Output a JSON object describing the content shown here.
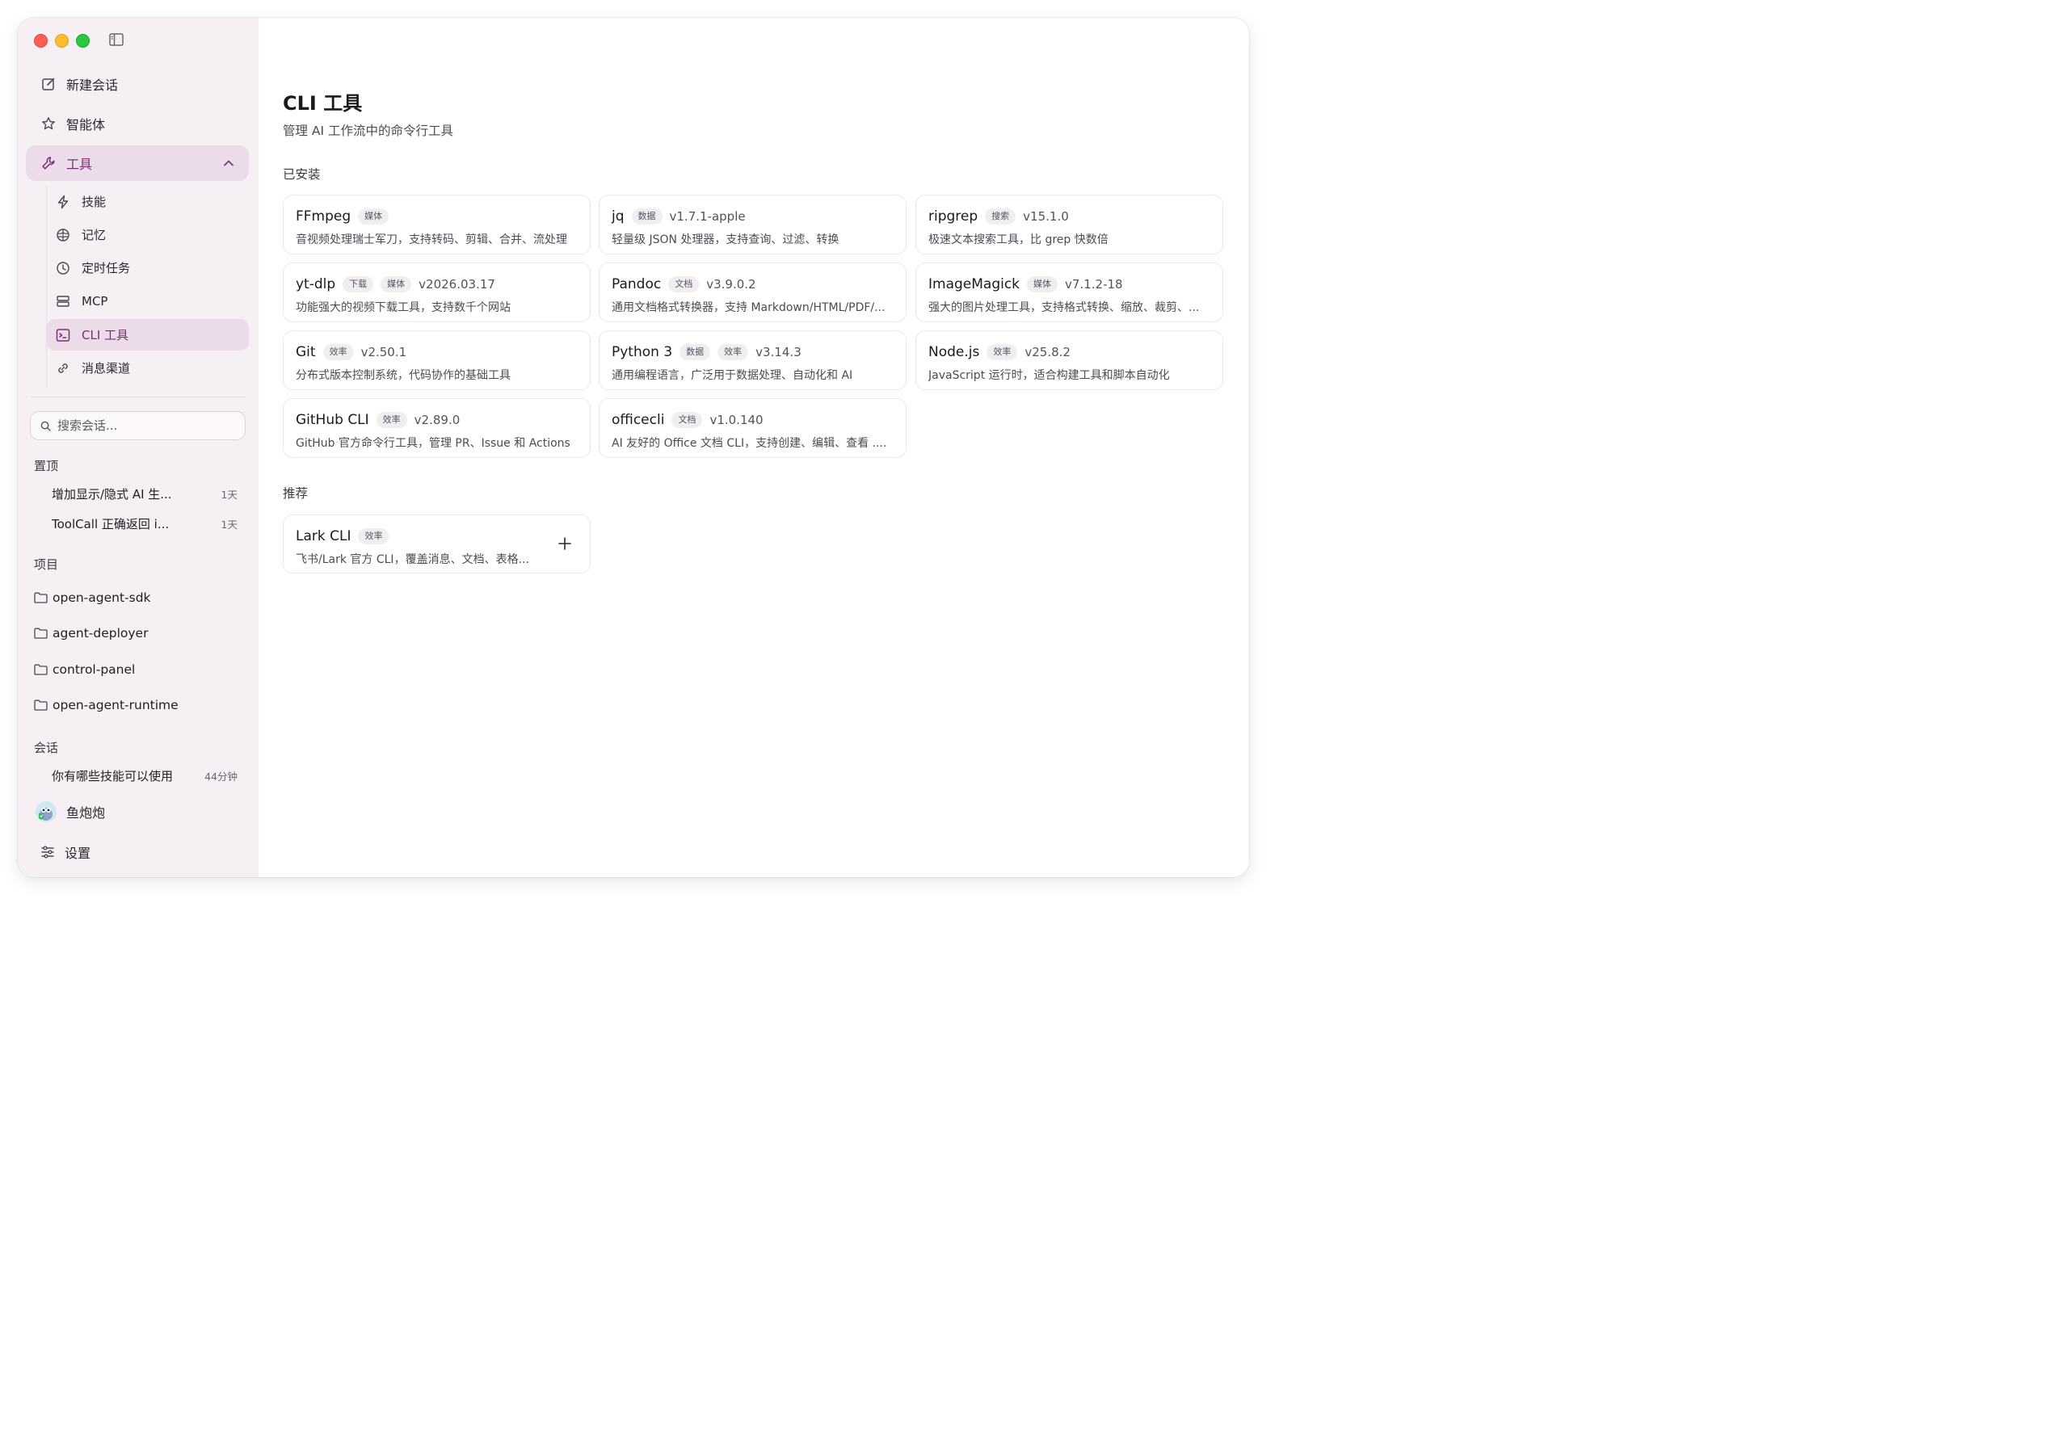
{
  "sidebar": {
    "nav": {
      "new_chat": "新建会话",
      "agents": "智能体",
      "tools": "工具"
    },
    "tools_sub": {
      "skills": "技能",
      "memory": "记忆",
      "scheduled": "定时任务",
      "mcp": "MCP",
      "cli": "CLI 工具",
      "channels": "消息渠道"
    },
    "search_placeholder": "搜索会话...",
    "pinned_label": "置顶",
    "pinned": [
      {
        "title": "增加显示/隐式 AI 生...",
        "time": "1天"
      },
      {
        "title": "ToolCall 正确返回 i...",
        "time": "1天"
      }
    ],
    "projects_label": "项目",
    "projects": [
      "open-agent-sdk",
      "agent-deployer",
      "control-panel",
      "open-agent-runtime"
    ],
    "conversations_label": "会话",
    "conversations": [
      {
        "title": "你有哪些技能可以使用",
        "time": "44分钟"
      }
    ],
    "user_name": "鱼炮炮",
    "settings": "设置"
  },
  "main": {
    "title": "CLI 工具",
    "subtitle": "管理 AI 工作流中的命令行工具",
    "installed_label": "已安装",
    "installed": [
      {
        "name": "FFmpeg",
        "tags": [
          "媒体"
        ],
        "version": "",
        "desc": "音视频处理瑞士军刀，支持转码、剪辑、合并、流处理"
      },
      {
        "name": "jq",
        "tags": [
          "数据"
        ],
        "version": "v1.7.1-apple",
        "desc": "轻量级 JSON 处理器，支持查询、过滤、转换"
      },
      {
        "name": "ripgrep",
        "tags": [
          "搜索"
        ],
        "version": "v15.1.0",
        "desc": "极速文本搜索工具，比 grep 快数倍"
      },
      {
        "name": "yt-dlp",
        "tags": [
          "下载",
          "媒体"
        ],
        "version": "v2026.03.17",
        "desc": "功能强大的视频下载工具，支持数千个网站"
      },
      {
        "name": "Pandoc",
        "tags": [
          "文档"
        ],
        "version": "v3.9.0.2",
        "desc": "通用文档格式转换器，支持 Markdown/HTML/PDF/..."
      },
      {
        "name": "ImageMagick",
        "tags": [
          "媒体"
        ],
        "version": "v7.1.2-18",
        "desc": "强大的图片处理工具，支持格式转换、缩放、裁剪、..."
      },
      {
        "name": "Git",
        "tags": [
          "效率"
        ],
        "version": "v2.50.1",
        "desc": "分布式版本控制系统，代码协作的基础工具"
      },
      {
        "name": "Python 3",
        "tags": [
          "数据",
          "效率"
        ],
        "version": "v3.14.3",
        "desc": "通用编程语言，广泛用于数据处理、自动化和 AI"
      },
      {
        "name": "Node.js",
        "tags": [
          "效率"
        ],
        "version": "v25.8.2",
        "desc": "JavaScript 运行时，适合构建工具和脚本自动化"
      },
      {
        "name": "GitHub CLI",
        "tags": [
          "效率"
        ],
        "version": "v2.89.0",
        "desc": "GitHub 官方命令行工具，管理 PR、Issue 和 Actions"
      },
      {
        "name": "officecli",
        "tags": [
          "文档"
        ],
        "version": "v1.0.140",
        "desc": "AI 友好的 Office 文档 CLI，支持创建、编辑、查看 ...."
      }
    ],
    "recommended_label": "推荐",
    "recommended": [
      {
        "name": "Lark CLI",
        "tags": [
          "效率"
        ],
        "version": "",
        "desc": "飞书/Lark 官方 CLI，覆盖消息、文档、表格..."
      }
    ]
  }
}
